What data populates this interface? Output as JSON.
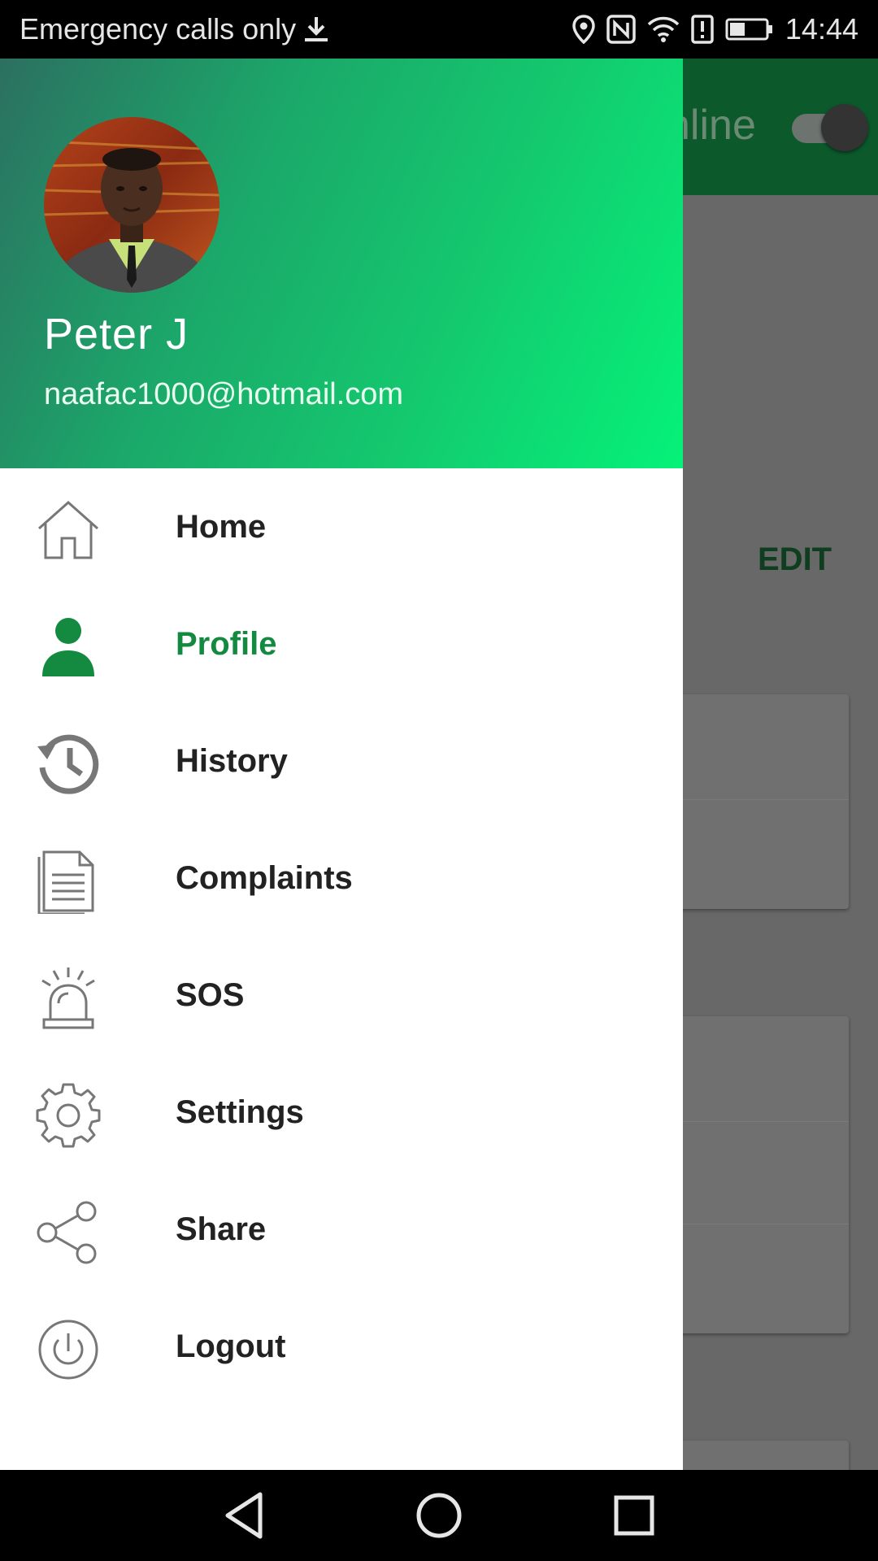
{
  "status_bar": {
    "carrier_text": "Emergency calls only",
    "time": "14:44",
    "icons": [
      "download-icon",
      "location-icon",
      "nfc-icon",
      "wifi-icon",
      "alert-icon",
      "battery-icon"
    ]
  },
  "background_app": {
    "toggle_label": "nline",
    "edit_label": "EDIT",
    "toolbar_color": "#0c5a2c"
  },
  "drawer": {
    "user": {
      "name": "Peter J",
      "email": "naafac1000@hotmail.com"
    },
    "menu": [
      {
        "id": "home",
        "label": "Home",
        "icon": "home-icon",
        "active": false
      },
      {
        "id": "profile",
        "label": "Profile",
        "icon": "person-icon",
        "active": true
      },
      {
        "id": "history",
        "label": "History",
        "icon": "history-icon",
        "active": false
      },
      {
        "id": "complaints",
        "label": "Complaints",
        "icon": "document-icon",
        "active": false
      },
      {
        "id": "sos",
        "label": "SOS",
        "icon": "siren-icon",
        "active": false
      },
      {
        "id": "settings",
        "label": "Settings",
        "icon": "gear-icon",
        "active": false
      },
      {
        "id": "share",
        "label": "Share",
        "icon": "share-icon",
        "active": false
      },
      {
        "id": "logout",
        "label": "Logout",
        "icon": "power-icon",
        "active": false
      }
    ],
    "accent_color": "#148a40",
    "header_gradient": [
      "#2c7060",
      "#05f279"
    ]
  },
  "nav_bar": {
    "buttons": [
      "back-icon",
      "home-circle-icon",
      "recents-icon"
    ]
  }
}
